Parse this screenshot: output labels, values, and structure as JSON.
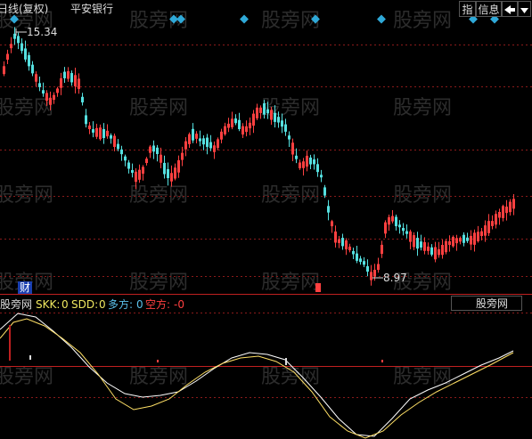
{
  "header": {
    "period_label": "日线(复权)",
    "stock_name": "平安银行",
    "buttons": [
      "指",
      "信息"
    ],
    "icon_names": [
      "arrow-left-icon",
      "dropdown-arrow-icon"
    ]
  },
  "price_chart": {
    "high_label": "15.34",
    "low_label": "8.97",
    "finance_marker": "财",
    "watermark": "股旁网"
  },
  "indicator_bar": {
    "name": "股旁网",
    "items": [
      {
        "label": "SKK:",
        "value": "0",
        "color": "#f0e860"
      },
      {
        "label": "SDD:",
        "value": "0",
        "color": "#f0e860"
      },
      {
        "label": "多方:",
        "value": "0",
        "color": "#5bc0eb"
      },
      {
        "label": "空方:",
        "value": "-0",
        "color": "#ff4040"
      }
    ],
    "dropdown_label": "股旁网"
  },
  "colors": {
    "up": "#ff4040",
    "down": "#55e0e0",
    "grid": "#8a1a1a",
    "diamond": "#2fa9d8",
    "line_white": "#ffffff",
    "line_yellow": "#ffe066"
  }
}
